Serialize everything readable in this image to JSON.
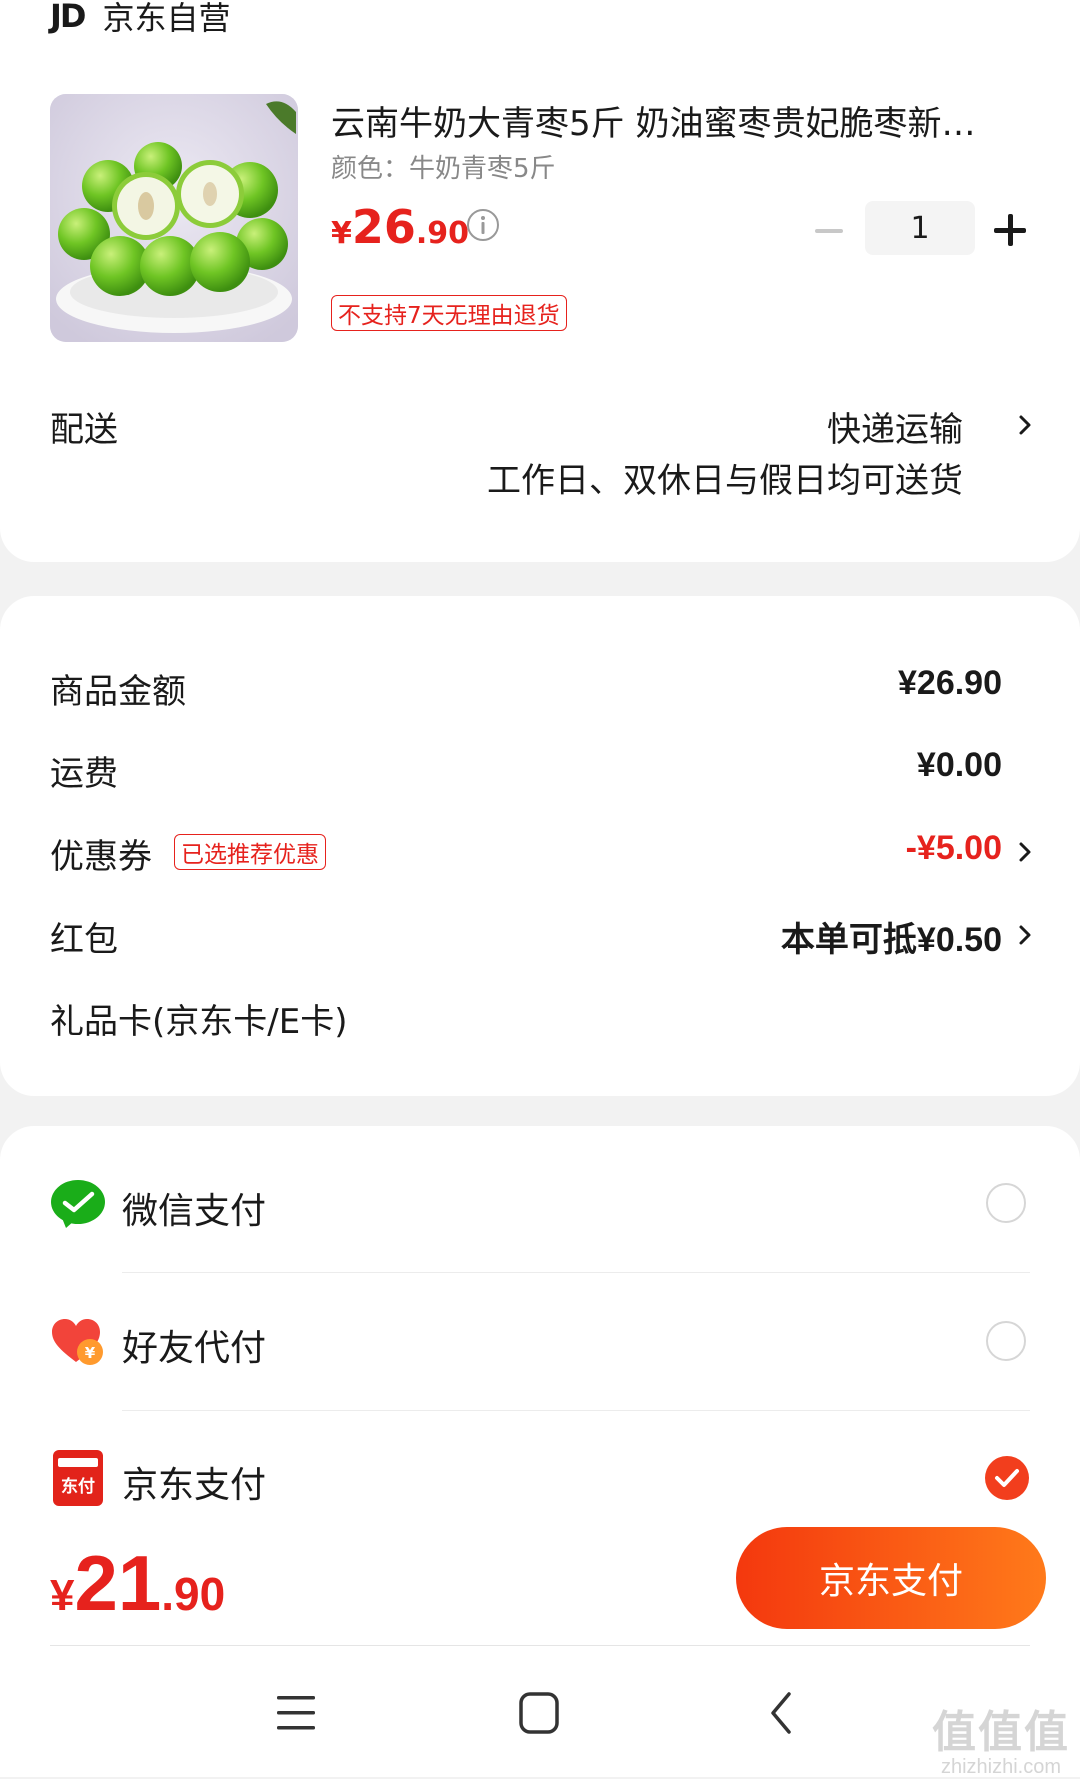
{
  "shop": {
    "logo_text": "JD",
    "name": "京东自营"
  },
  "product": {
    "title": "云南牛奶大青枣5斤 奶油蜜枣贵妃脆枣新…",
    "spec": "颜色：牛奶青枣5斤",
    "price_currency": "¥",
    "price_int": "26",
    "price_dec": ".90",
    "quantity": "1",
    "return_tag": "不支持7天无理由退货"
  },
  "delivery": {
    "label": "配送",
    "method": "快递运输",
    "note": "工作日、双休日与假日均可送货"
  },
  "amounts": {
    "goods_label": "商品金额",
    "goods_value": "¥26.90",
    "shipping_label": "运费",
    "shipping_value": "¥0.00",
    "coupon_label": "优惠券",
    "coupon_tag": "已选推荐优惠",
    "coupon_value": "-¥5.00",
    "redpacket_label": "红包",
    "redpacket_value": "本单可抵¥0.50",
    "giftcard_label": "礼品卡(京东卡/E卡)"
  },
  "payment": {
    "options": [
      {
        "label": "微信支付",
        "icon": "wechat-pay-icon",
        "selected": false
      },
      {
        "label": "好友代付",
        "icon": "friend-pay-heart-icon",
        "selected": false
      },
      {
        "label": "京东支付",
        "icon": "jd-pay-icon",
        "selected": true
      }
    ],
    "jd_pay_icon_text": "东付"
  },
  "bottom": {
    "total_currency": "¥",
    "total_int": "21",
    "total_dec": ".90",
    "pay_button": "京东支付"
  },
  "watermark": {
    "main": "值值值",
    "sub": "zhizhizhi.com"
  },
  "colors": {
    "accent_red": "#e6221d",
    "button_gradient_start": "#f4380e",
    "button_gradient_end": "#ff7a1a",
    "wechat_green": "#1aad19"
  }
}
